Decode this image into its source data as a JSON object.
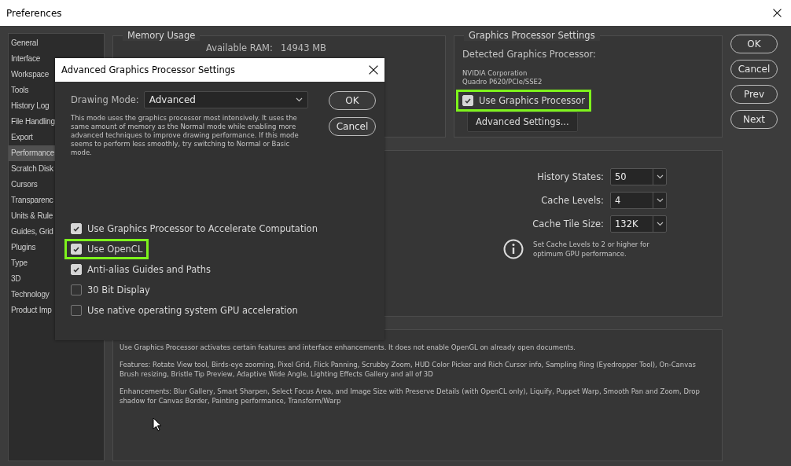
{
  "window": {
    "title": "Preferences"
  },
  "sidebar": {
    "items": [
      {
        "label": "General",
        "selected": false
      },
      {
        "label": "Interface",
        "selected": false
      },
      {
        "label": "Workspace",
        "selected": false
      },
      {
        "label": "Tools",
        "selected": false
      },
      {
        "label": "History Log",
        "selected": false
      },
      {
        "label": "File Handling",
        "selected": false
      },
      {
        "label": "Export",
        "selected": false
      },
      {
        "label": "Performance",
        "selected": true
      },
      {
        "label": "Scratch Disk",
        "selected": false
      },
      {
        "label": "Cursors",
        "selected": false
      },
      {
        "label": "Transparenc",
        "selected": false
      },
      {
        "label": "Units & Rule",
        "selected": false
      },
      {
        "label": "Guides, Grid",
        "selected": false
      },
      {
        "label": "Plugins",
        "selected": false
      },
      {
        "label": "Type",
        "selected": false
      },
      {
        "label": "3D",
        "selected": false
      },
      {
        "label": "Technology",
        "selected": false
      },
      {
        "label": "Product Imp",
        "selected": false
      }
    ]
  },
  "memory_usage": {
    "title": "Memory Usage",
    "available_ram_label": "Available RAM:",
    "available_ram_value": "14943 MB"
  },
  "gpu_settings": {
    "title": "Graphics Processor Settings",
    "detected_label": "Detected Graphics Processor:",
    "vendor": "NVIDIA Corporation",
    "model": "Quadro P620/PCIe/SSE2",
    "use_gpu": {
      "label": "Use Graphics Processor",
      "checked": true,
      "highlighted": true
    },
    "advanced_button": "Advanced Settings..."
  },
  "history_cache": {
    "fields": [
      {
        "label": "History States:",
        "value": "50"
      },
      {
        "label": "Cache Levels:",
        "value": "4"
      },
      {
        "label": "Cache Tile Size:",
        "value": "132K"
      }
    ],
    "note": "Set Cache Levels to 2 or higher for optimum GPU performance."
  },
  "description": {
    "paragraphs": [
      "Use Graphics Processor activates certain features and interface enhancements. It does not enable OpenGL on already open documents.",
      "Features: Rotate View tool, Birds-eye zooming, Pixel Grid, Flick Panning, Scrubby Zoom, HUD Color Picker and Rich Cursor info, Sampling Ring (Eyedropper Tool), On-Canvas Brush resizing, Bristle Tip Preview, Adaptive Wide Angle, Lighting Effects Gallery and all of 3D",
      "Enhancements: Blur Gallery, Smart Sharpen, Select Focus Area, and Image Size with Preserve Details (with OpenCL only), Liquify, Puppet Warp, Smooth Pan and Zoom, Drop shadow for Canvas Border, Painting performance, Transform/Warp"
    ]
  },
  "buttons": [
    "OK",
    "Cancel",
    "Prev",
    "Next"
  ],
  "dialog": {
    "title": "Advanced Graphics Processor Settings",
    "drawing_mode": {
      "label": "Drawing Mode:",
      "value": "Advanced"
    },
    "description": "This mode uses the graphics processor most intensively.  It uses the same amount of memory as the Normal mode while enabling more advanced techniques to improve drawing performance.  If this mode seems to perform less smoothly, try switching to Normal or Basic mode.",
    "buttons": [
      "OK",
      "Cancel"
    ],
    "options": [
      {
        "label": "Use Graphics Processor to Accelerate Computation",
        "checked": true,
        "highlighted": false
      },
      {
        "label": "Use OpenCL",
        "checked": true,
        "highlighted": true
      },
      {
        "label": "Anti-alias Guides and Paths",
        "checked": true,
        "highlighted": false
      },
      {
        "label": "30 Bit Display",
        "checked": false,
        "highlighted": false
      },
      {
        "label": "Use native operating system GPU acceleration",
        "checked": false,
        "highlighted": false
      }
    ]
  }
}
